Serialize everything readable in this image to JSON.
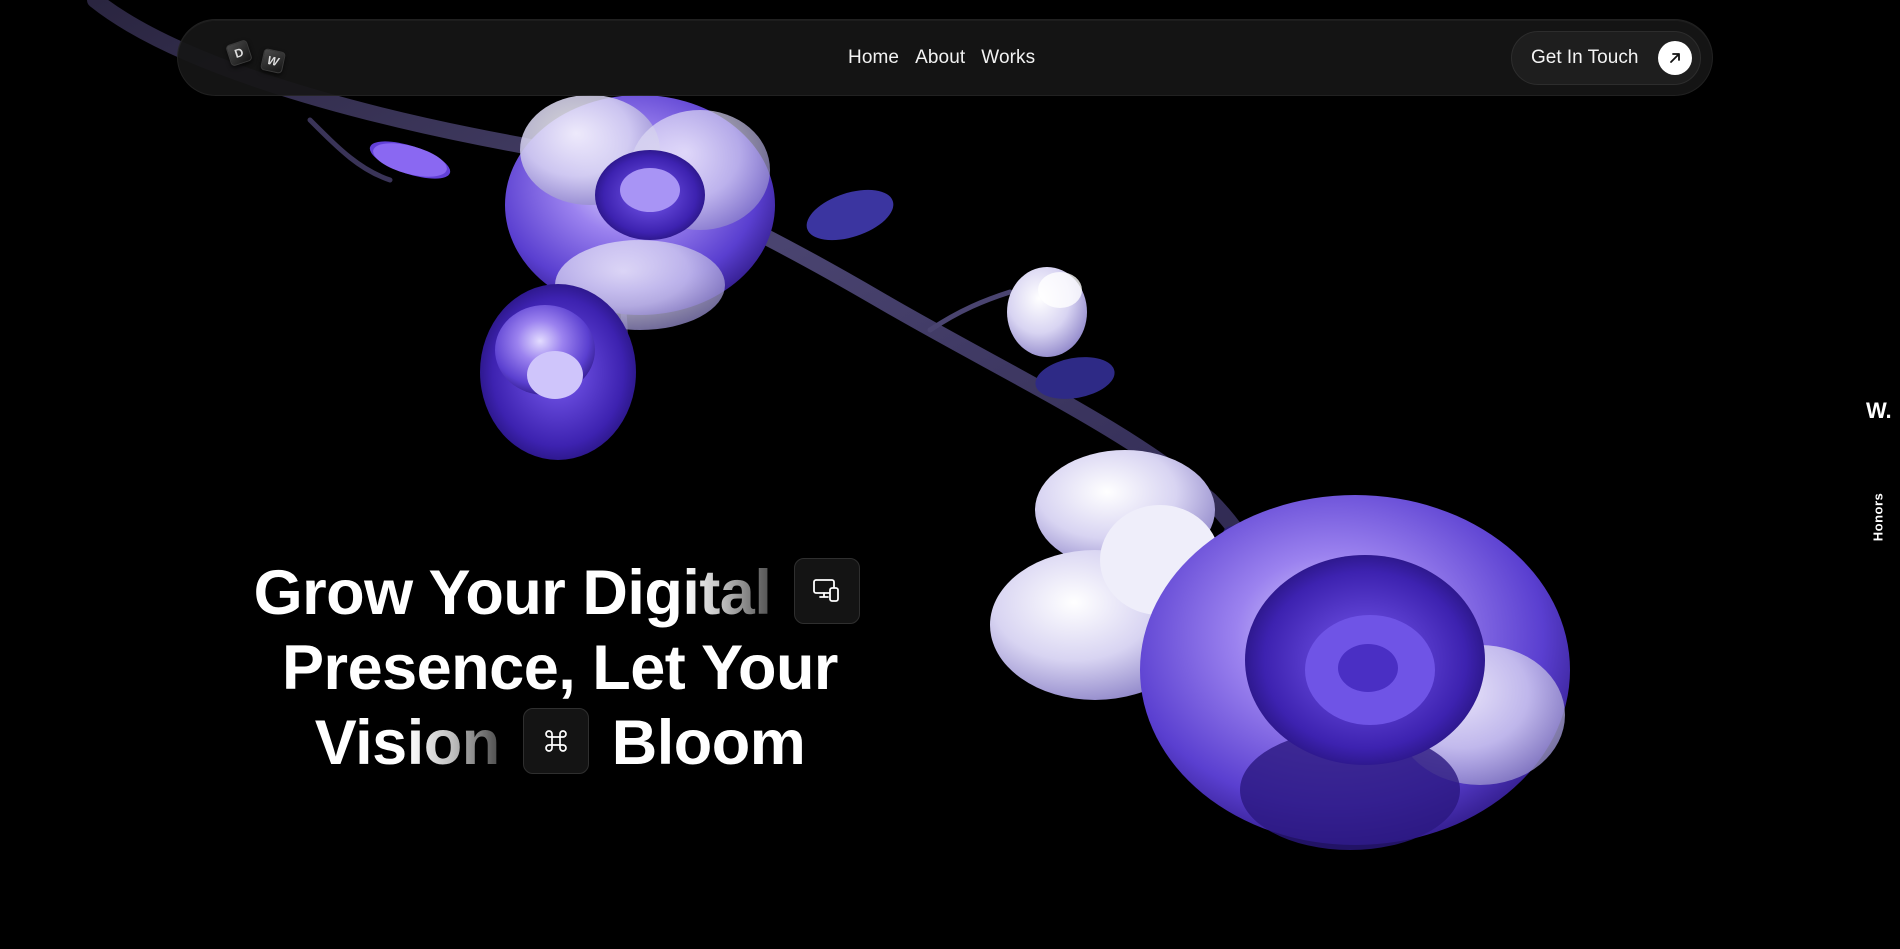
{
  "brand": {
    "logo_letters": [
      "D",
      "W"
    ],
    "rail_logo": "W."
  },
  "nav": {
    "items": [
      {
        "label": "Home"
      },
      {
        "label": "About"
      },
      {
        "label": "Works"
      }
    ],
    "cta_label": "Get In Touch",
    "cta_icon": "arrow-up-right-icon"
  },
  "hero": {
    "line1_a": "Grow Your Dig",
    "line1_b": "ital",
    "line2": "Presence, Let Your",
    "line3_a": "Vis",
    "line3_b": "ion",
    "line3_c": "Bloom",
    "chip1_icon": "devices-icon",
    "chip2_icon": "command-icon"
  },
  "side_rail": {
    "label": "Honors"
  },
  "colors": {
    "background": "#000000",
    "navbar": "#161616",
    "flower_primary": "#6a4fd8",
    "flower_light": "#d9d6f5",
    "text": "#ffffff"
  }
}
